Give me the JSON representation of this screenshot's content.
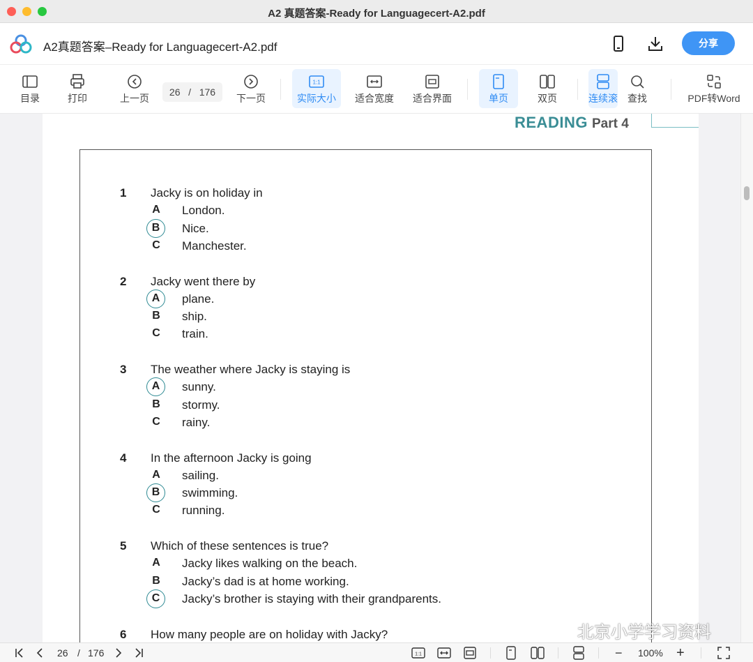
{
  "window": {
    "title": "A2 真题答案-Ready for Languagecert-A2.pdf"
  },
  "header": {
    "filename": "A2真题答案–Ready for Languagecert-A2.pdf",
    "share_label": "分享"
  },
  "toolbar": {
    "toc": "目录",
    "print": "打印",
    "prev": "上一页",
    "page_current": "26",
    "page_sep": "/",
    "page_total": "176",
    "next": "下一页",
    "actual_size": "实际大小",
    "fit_width": "适合宽度",
    "fit_page": "适合界面",
    "single": "单页",
    "double": "双页",
    "continuous": "连续滚",
    "find": "查找",
    "pdf_to_word": "PDF转Word"
  },
  "document": {
    "section_word": "READING",
    "section_part": "Part 4",
    "questions": [
      {
        "num": "1",
        "text": "Jacky is on holiday in",
        "options": [
          {
            "letter": "A",
            "text": "London.",
            "circled": false
          },
          {
            "letter": "B",
            "text": "Nice.",
            "circled": true
          },
          {
            "letter": "C",
            "text": "Manchester.",
            "circled": false
          }
        ]
      },
      {
        "num": "2",
        "text": "Jacky went there by",
        "options": [
          {
            "letter": "A",
            "text": "plane.",
            "circled": true
          },
          {
            "letter": "B",
            "text": "ship.",
            "circled": false
          },
          {
            "letter": "C",
            "text": "train.",
            "circled": false
          }
        ]
      },
      {
        "num": "3",
        "text": "The weather where Jacky is staying is",
        "options": [
          {
            "letter": "A",
            "text": "sunny.",
            "circled": true
          },
          {
            "letter": "B",
            "text": "stormy.",
            "circled": false
          },
          {
            "letter": "C",
            "text": "rainy.",
            "circled": false
          }
        ]
      },
      {
        "num": "4",
        "text": "In the afternoon Jacky is going",
        "options": [
          {
            "letter": "A",
            "text": "sailing.",
            "circled": false
          },
          {
            "letter": "B",
            "text": "swimming.",
            "circled": true
          },
          {
            "letter": "C",
            "text": "running.",
            "circled": false
          }
        ]
      },
      {
        "num": "5",
        "text": "Which of these sentences is true?",
        "options": [
          {
            "letter": "A",
            "text": "Jacky likes walking on the beach.",
            "circled": false
          },
          {
            "letter": "B",
            "text": "Jacky’s dad is at home working.",
            "circled": false
          },
          {
            "letter": "C",
            "text": "Jacky’s brother is staying with their grandparents.",
            "circled": true
          }
        ]
      },
      {
        "num": "6",
        "text": "How many people are on holiday with Jacky?",
        "options": []
      }
    ]
  },
  "watermark": {
    "text": "北京小学学习资料"
  },
  "statusbar": {
    "page_current": "26",
    "page_sep": "/",
    "page_total": "176",
    "zoom_minus": "−",
    "zoom_level": "100%",
    "zoom_plus": "+"
  },
  "colors": {
    "accent": "#3f95f5",
    "reading_teal": "#3a8d95",
    "answer_circle": "#2e8a93"
  },
  "icons": [
    "app-logo-icon",
    "phone-icon",
    "download-icon",
    "toc-icon",
    "print-icon",
    "prev-page-icon",
    "next-page-icon",
    "actual-size-icon",
    "fit-width-icon",
    "fit-page-icon",
    "single-page-icon",
    "double-page-icon",
    "continuous-scroll-icon",
    "search-icon",
    "pdf-to-word-icon",
    "first-page-icon",
    "last-page-icon",
    "expand-icon",
    "wechat-icon"
  ]
}
